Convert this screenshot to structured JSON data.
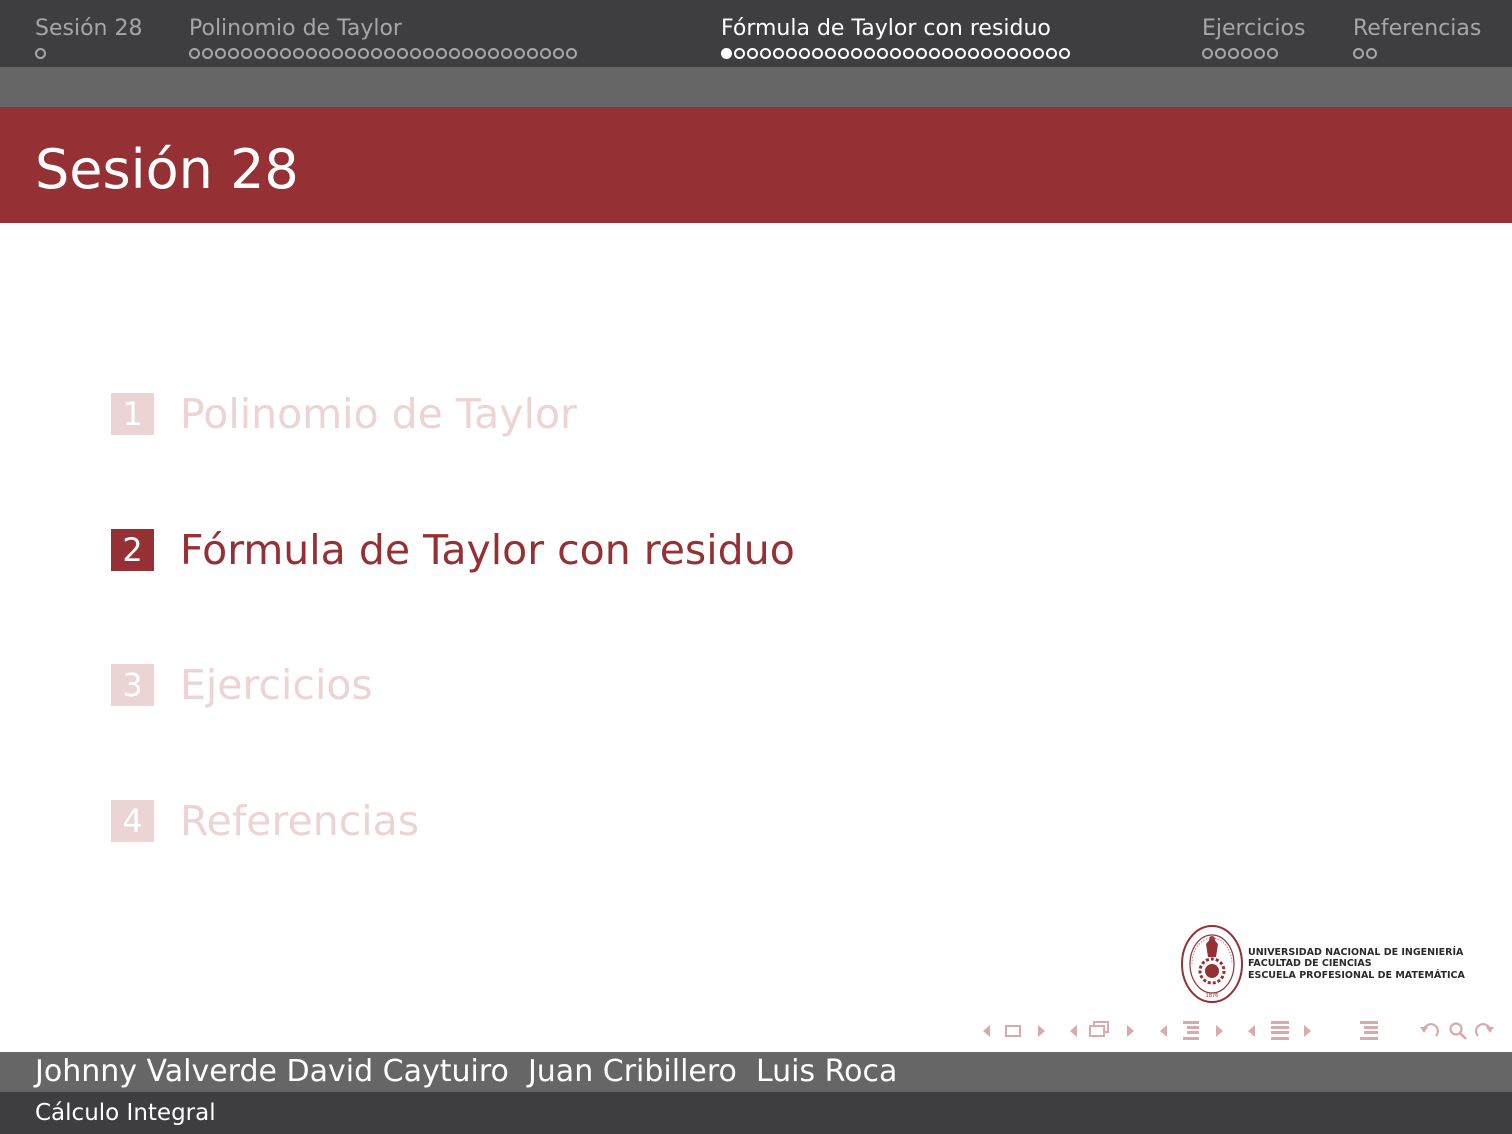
{
  "headline": {
    "sections": [
      {
        "label": "Sesión 28",
        "dots": 1,
        "filled": 0
      },
      {
        "label": "Polinomio de Taylor",
        "dots": 30,
        "filled": 0
      },
      {
        "label": "Fórmula de Taylor con residuo",
        "dots": 27,
        "filled": 1
      },
      {
        "label": "Ejercicios",
        "dots": 6,
        "filled": 0
      },
      {
        "label": "Referencias",
        "dots": 2,
        "filled": 0
      }
    ],
    "active_index": 2
  },
  "frame": {
    "title": "Sesión 28"
  },
  "toc": {
    "items": [
      {
        "num": "1",
        "text": "Polinomio de Taylor"
      },
      {
        "num": "2",
        "text": "Fórmula de Taylor con residuo"
      },
      {
        "num": "3",
        "text": "Ejercicios"
      },
      {
        "num": "4",
        "text": "Referencias"
      }
    ],
    "current_index": 1
  },
  "logo": {
    "seal_text": "UNIVERSIDAD NACIONAL DE INGENIERÍA 1876",
    "lines": [
      "UNIVERSIDAD NACIONAL DE INGENIERÍA",
      "FACULTAD DE CIENCIAS",
      "ESCUELA PROFESIONAL DE MATEMÁTICA"
    ]
  },
  "footer": {
    "authors": "Johnny Valverde David Caytuiro  Juan Cribillero  Luis Roca",
    "course": "Cálculo Integral"
  },
  "colors": {
    "accent": "#953034",
    "accent_dim": "#ecd3d4",
    "dark_bar": "#3e3e40",
    "mid_bar": "#666666",
    "nav_inactive": "#a6a6a8",
    "nav_symbol": "#d9a9ab"
  },
  "nav_symbols": [
    "slide-nav",
    "frame-nav",
    "subsection-nav",
    "section-nav",
    "document-nav",
    "back-forward-search"
  ]
}
